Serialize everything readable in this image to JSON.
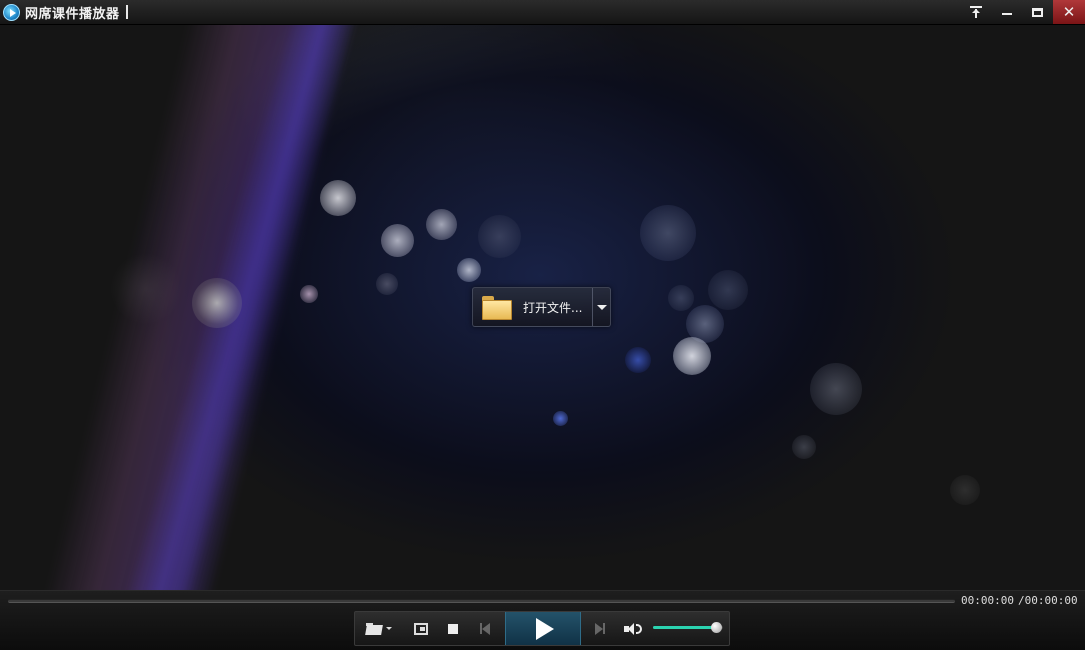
{
  "window": {
    "title": "网席课件播放器",
    "buttons": [
      "pin-top",
      "minimize",
      "maximize",
      "close"
    ],
    "close_label": "✕"
  },
  "stage": {
    "open_file_label": "打开文件..."
  },
  "player": {
    "time_current": "00:00:00",
    "time_total": "/00:00:00",
    "progress": 0,
    "volume": 0.9,
    "accent_color": "#2bd3b0"
  },
  "toolbar": {
    "icons": [
      "open-folder-icon",
      "playlist-icon",
      "stop-icon",
      "previous-icon",
      "play-icon",
      "next-icon",
      "speaker-icon"
    ]
  }
}
